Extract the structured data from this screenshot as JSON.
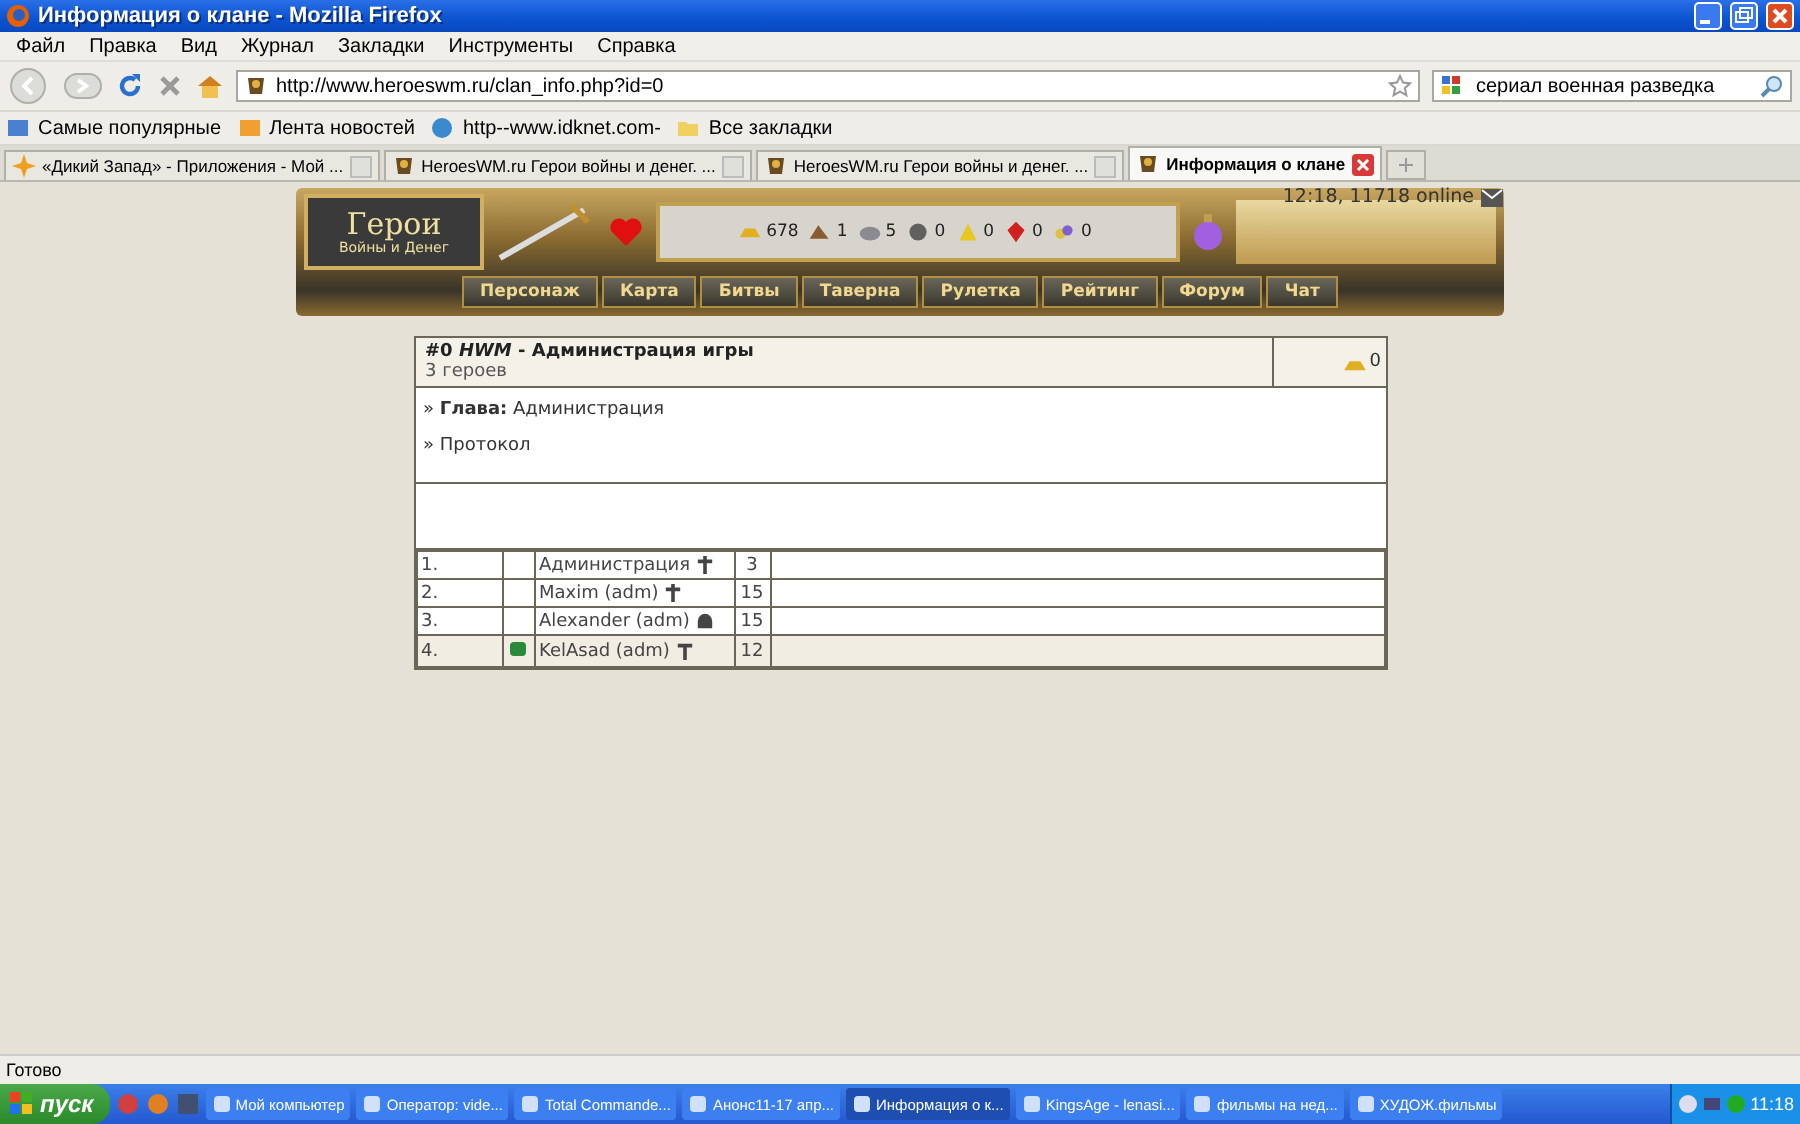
{
  "window": {
    "title": "Информация о клане - Mozilla Firefox"
  },
  "menu": [
    "Файл",
    "Правка",
    "Вид",
    "Журнал",
    "Закладки",
    "Инструменты",
    "Справка"
  ],
  "address_bar": {
    "value": "http://www.heroeswm.ru/clan_info.php?id=0"
  },
  "search": {
    "value": "сериал военная разведка"
  },
  "bookmarks": [
    "Самые популярные",
    "Лента новостей",
    "http--www.idknet.com-",
    "Все закладки"
  ],
  "tabs": [
    {
      "label": "«Дикий Запад» - Приложения - Мой ...",
      "selected": false
    },
    {
      "label": "HeroesWM.ru Герои войны и денег. ...",
      "selected": false
    },
    {
      "label": "HeroesWM.ru Герои войны и денег. ...",
      "selected": false
    },
    {
      "label": "Информация о клане",
      "selected": true
    }
  ],
  "game": {
    "logo": {
      "title": "Герои",
      "subtitle": "Войны и Денег"
    },
    "resources": [
      {
        "kind": "gold",
        "amount": "678"
      },
      {
        "kind": "wood",
        "amount": "1"
      },
      {
        "kind": "ore",
        "amount": "5"
      },
      {
        "kind": "mercury",
        "amount": "0"
      },
      {
        "kind": "sulfur",
        "amount": "0"
      },
      {
        "kind": "crystal",
        "amount": "0"
      },
      {
        "kind": "gems",
        "amount": "0"
      }
    ],
    "server_status": "12:18, 11718 online",
    "nav": [
      "Персонаж",
      "Карта",
      "Битвы",
      "Таверна",
      "Рулетка",
      "Рейтинг",
      "Форум",
      "Чат"
    ]
  },
  "clan": {
    "title": "#0 *HWM* - Администрация игры",
    "members_count": "3 героев",
    "gold": "0",
    "leader": "» **Глава:** Администрация",
    "protocol_link": "» Протокол",
    "members": [
      {
        "number": "1.",
        "badge": false,
        "name": "Администрация",
        "kind": "cross",
        "hero_level": "3",
        "selected": false
      },
      {
        "number": "2.",
        "badge": false,
        "name": "Maxim (adm)",
        "kind": "cross",
        "hero_level": "15",
        "selected": false
      },
      {
        "number": "3.",
        "badge": false,
        "name": "Alexander (adm)",
        "kind": "helmet",
        "hero_level": "15",
        "selected": false
      },
      {
        "number": "4.",
        "badge": true,
        "name": "KelAsad (adm)",
        "kind": "hammer",
        "hero_level": "12",
        "selected": true
      }
    ]
  },
  "status_bar": "Готово",
  "taskbar": {
    "start": "пуск",
    "items": [
      {
        "label": "Мой компьютер",
        "selected": false
      },
      {
        "label": "Оператор: vide...",
        "selected": false
      },
      {
        "label": "Total Commande...",
        "selected": false
      },
      {
        "label": "Анонс11-17 апр...",
        "selected": false
      },
      {
        "label": "Информация о к...",
        "selected": true
      },
      {
        "label": "KingsAge - lenasi...",
        "selected": false
      },
      {
        "label": "фильмы на нед...",
        "selected": false
      },
      {
        "label": "ХУДОЖ.фильмы",
        "selected": false
      }
    ],
    "clock": "11:18"
  }
}
